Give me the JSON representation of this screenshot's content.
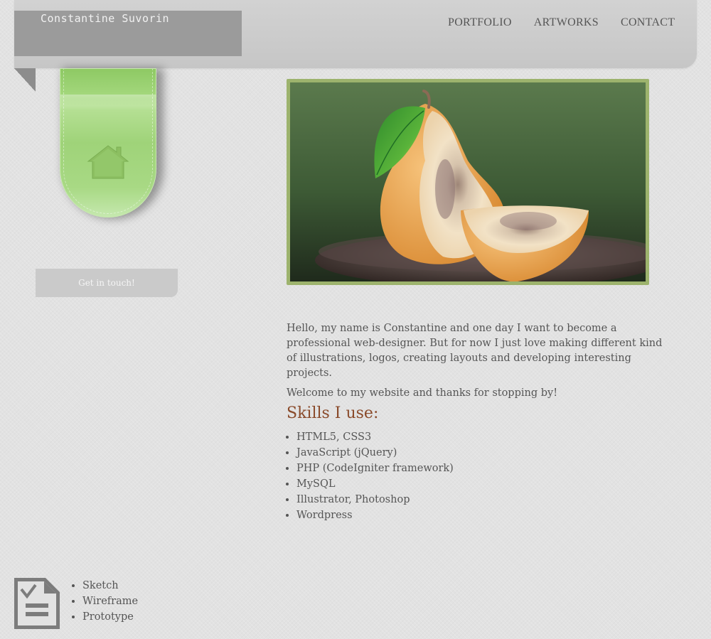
{
  "header": {
    "logo_text": "Constantine Suvorin",
    "nav": [
      "PORTFOLIO",
      "ARTWORKS",
      "CONTACT"
    ]
  },
  "sidebar": {
    "ribbon_icon": "home-icon",
    "touch_button": "Get in touch!"
  },
  "main": {
    "hero_image": "pear-illustration",
    "intro": [
      "Hello, my name is Constantine and one day I want to become a professional web-designer. But for now I just love making different kind of illustrations, logos, creating layouts and developing interesting projects.",
      "Welcome to my website and thanks for stopping by!"
    ],
    "skills_title": "Skills I use:",
    "skills": [
      "HTML5, CSS3",
      "JavaScript (jQuery)",
      "PHP (CodeIgniter framework)",
      "MySQL",
      "Illustrator, Photoshop",
      "Wordpress"
    ]
  },
  "bottom": {
    "icon": "document-check-icon",
    "items": [
      "Sketch",
      "Wireframe",
      "Prototype"
    ]
  },
  "colors": {
    "ribbon_green": "#9fd379",
    "hero_border": "#9db36d",
    "skills_title": "#8a4a2a"
  }
}
